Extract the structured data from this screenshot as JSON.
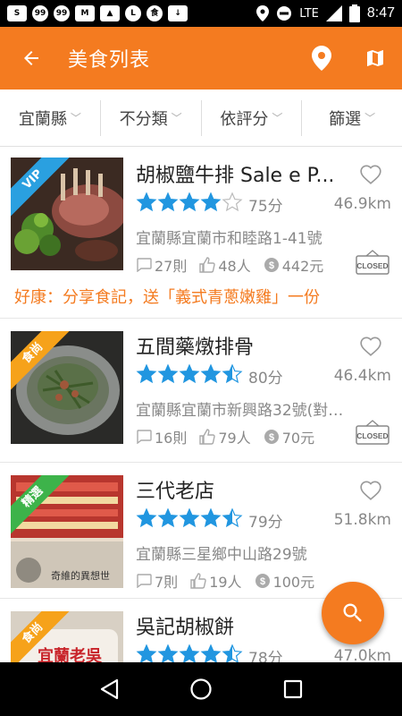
{
  "status_bar": {
    "time": "8:47",
    "network": "LTE",
    "left_icons": [
      "sohu-icon",
      "chat-icon",
      "chat-icon",
      "gmail-icon",
      "image-icon",
      "line-icon",
      "food-app-icon",
      "download-icon"
    ]
  },
  "app_bar": {
    "title": "美食列表"
  },
  "filters": [
    {
      "label": "宜蘭縣"
    },
    {
      "label": "不分類"
    },
    {
      "label": "依評分"
    },
    {
      "label": "篩選"
    }
  ],
  "restaurants": [
    {
      "name": "胡椒鹽牛排 Sale e P...",
      "badge": "VIP",
      "badge_color": "#2aa0e0",
      "rating": 4,
      "score": "75分",
      "distance": "46.9km",
      "address": "宜蘭縣宜蘭市和睦路1-41號",
      "comments": "27則",
      "likes": "48人",
      "price": "442元",
      "closed": true,
      "promo": "好康：分享食記，送「義式青蔥嫩雞」一份"
    },
    {
      "name": "五間藥燉排骨",
      "badge": "食尚",
      "badge_color": "#f6a21a",
      "rating": 4.5,
      "score": "80分",
      "distance": "46.4km",
      "address": "宜蘭縣宜蘭市新興路32號(對面...",
      "comments": "16則",
      "likes": "79人",
      "price": "70元",
      "closed": true,
      "promo": ""
    },
    {
      "name": "三代老店",
      "badge": "精選",
      "badge_color": "#3db34a",
      "rating": 4.5,
      "score": "79分",
      "distance": "51.8km",
      "address": "宜蘭縣三星鄉中山路29號",
      "comments": "7則",
      "likes": "19人",
      "price": "100元",
      "closed": false,
      "promo": ""
    },
    {
      "name": "吳記胡椒餅",
      "badge": "食尚",
      "badge_color": "#f6a21a",
      "rating": 4.5,
      "score": "78分",
      "distance": "47.0km",
      "address": "",
      "comments": "",
      "likes": "",
      "price": "",
      "closed": false,
      "promo": ""
    }
  ],
  "closed_stamp_text": "CLOSED",
  "colors": {
    "accent": "#f47b20",
    "star": "#2196e0"
  }
}
